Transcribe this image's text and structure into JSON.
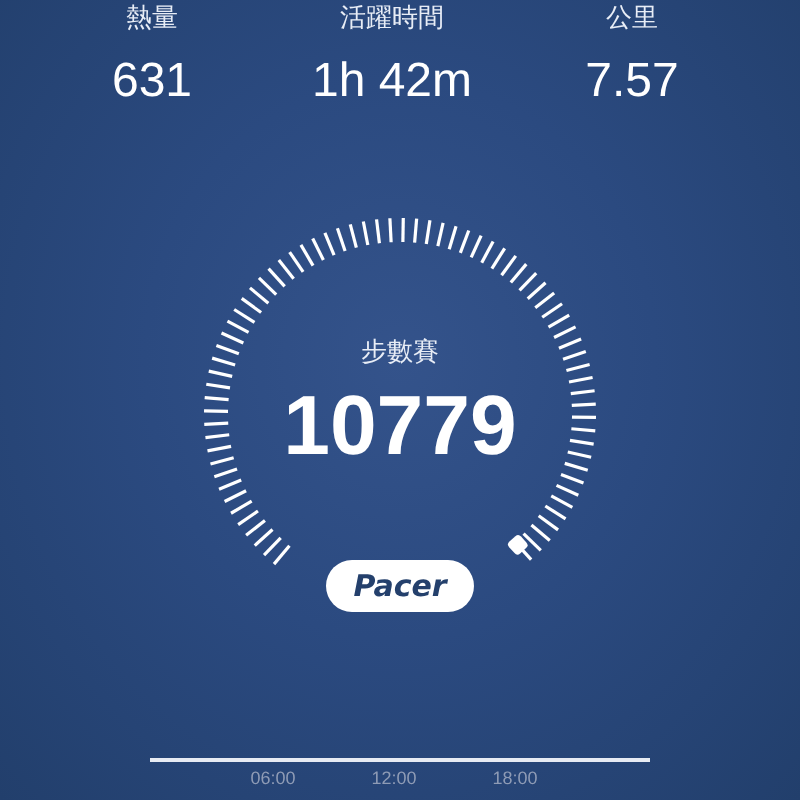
{
  "stats": [
    {
      "label": "熱量",
      "value": "631"
    },
    {
      "label": "活躍時間",
      "value": "1h 42m"
    },
    {
      "label": "公里",
      "value": "7.57"
    }
  ],
  "gauge": {
    "label": "步數賽",
    "value": "10779"
  },
  "brand_button": {
    "label": "Pacer"
  },
  "timeline": {
    "labels": [
      "06:00",
      "12:00",
      "18:00"
    ]
  }
}
